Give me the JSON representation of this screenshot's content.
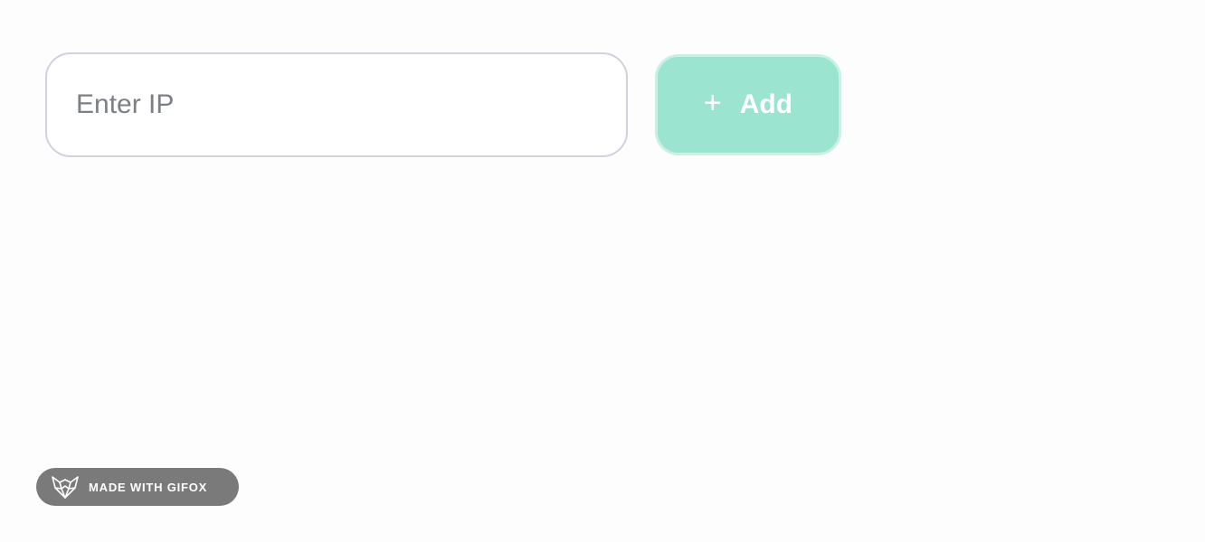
{
  "ip_form": {
    "input_placeholder": "Enter IP",
    "input_value": "",
    "add_button": {
      "icon": "plus-icon",
      "icon_glyph": "+",
      "label": "Add"
    }
  },
  "watermark": {
    "icon": "fox-icon",
    "label": "MADE WITH GIFOX"
  },
  "colors": {
    "accent": "#9be5d0",
    "input_border": "#cfd3dd",
    "badge_bg": "#7a7a7a"
  }
}
